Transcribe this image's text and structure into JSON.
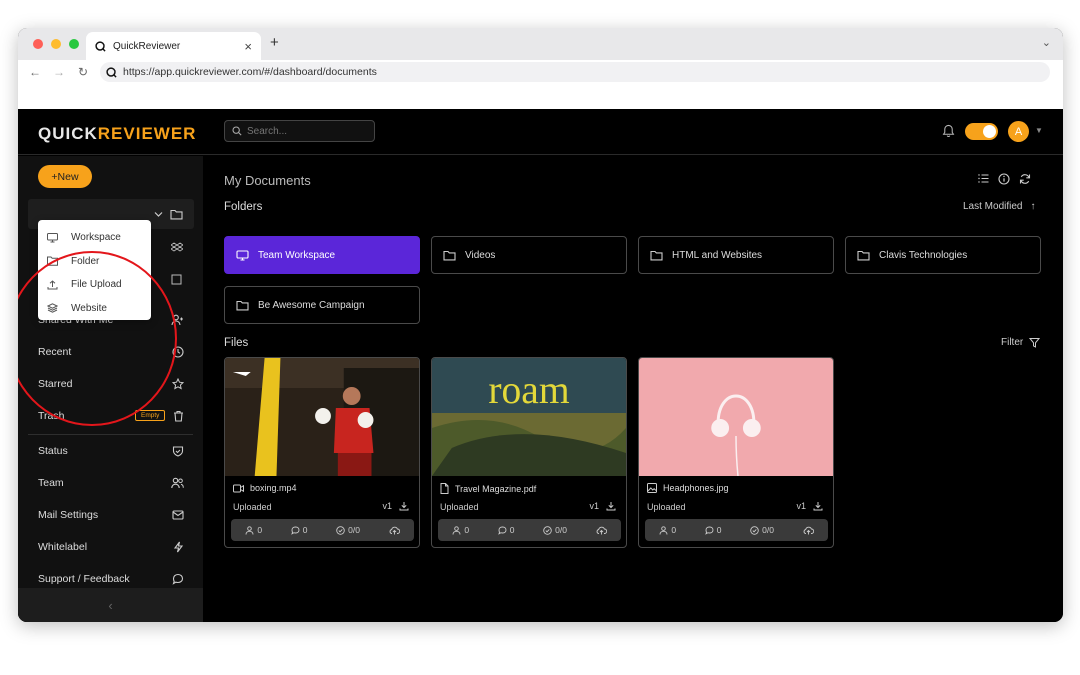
{
  "browser": {
    "tab_title": "QuickReviewer",
    "url": "https://app.quickreviewer.com/#/dashboard/documents",
    "traffic_lights": [
      "#fe5f57",
      "#febc2e",
      "#28c840"
    ]
  },
  "header": {
    "logo_part1": "QUICK",
    "logo_part2": "REVIEWER",
    "search_placeholder": "Search...",
    "avatar_initial": "A",
    "accent_color": "#f7a21b"
  },
  "sidebar": {
    "new_button": "+New",
    "items": [
      {
        "label": "Shared With Me",
        "icon": "user-plus-icon"
      },
      {
        "label": "Recent",
        "icon": "clock-icon"
      },
      {
        "label": "Starred",
        "icon": "star-icon"
      },
      {
        "label": "Trash",
        "icon": "trash-icon",
        "badge": "Empty"
      },
      {
        "label": "Status",
        "icon": "shield-check-icon"
      },
      {
        "label": "Team",
        "icon": "users-icon"
      },
      {
        "label": "Mail Settings",
        "icon": "mail-icon"
      },
      {
        "label": "Whitelabel",
        "icon": "bolt-icon"
      },
      {
        "label": "Support / Feedback",
        "icon": "chat-icon"
      }
    ],
    "collapse_glyph": "‹"
  },
  "new_menu": {
    "items": [
      {
        "label": "Workspace",
        "icon": "monitor-icon"
      },
      {
        "label": "Folder",
        "icon": "folder-icon"
      },
      {
        "label": "File Upload",
        "icon": "upload-icon"
      },
      {
        "label": "Website",
        "icon": "layers-icon"
      }
    ]
  },
  "main": {
    "title": "My Documents",
    "folders_heading": "Folders",
    "sort_label": "Last Modified",
    "folders": [
      {
        "label": "Team Workspace",
        "active": true
      },
      {
        "label": "Videos"
      },
      {
        "label": "HTML and Websites"
      },
      {
        "label": "Clavis Technologies"
      },
      {
        "label": "Be Awesome Campaign"
      }
    ],
    "files_heading": "Files",
    "filter_label": "Filter",
    "files": [
      {
        "name": "boxing.mp4",
        "type": "video-icon",
        "status": "Uploaded",
        "version": "v1",
        "reviewers": "0",
        "comments": "0",
        "approvals": "0/0"
      },
      {
        "name": "Travel Magazine.pdf",
        "type": "document-icon",
        "status": "Uploaded",
        "version": "v1",
        "reviewers": "0",
        "comments": "0",
        "approvals": "0/0",
        "thumb_title": "roam"
      },
      {
        "name": "Headphones.jpg",
        "type": "image-icon",
        "status": "Uploaded",
        "version": "v1",
        "reviewers": "0",
        "comments": "0",
        "approvals": "0/0"
      }
    ]
  }
}
